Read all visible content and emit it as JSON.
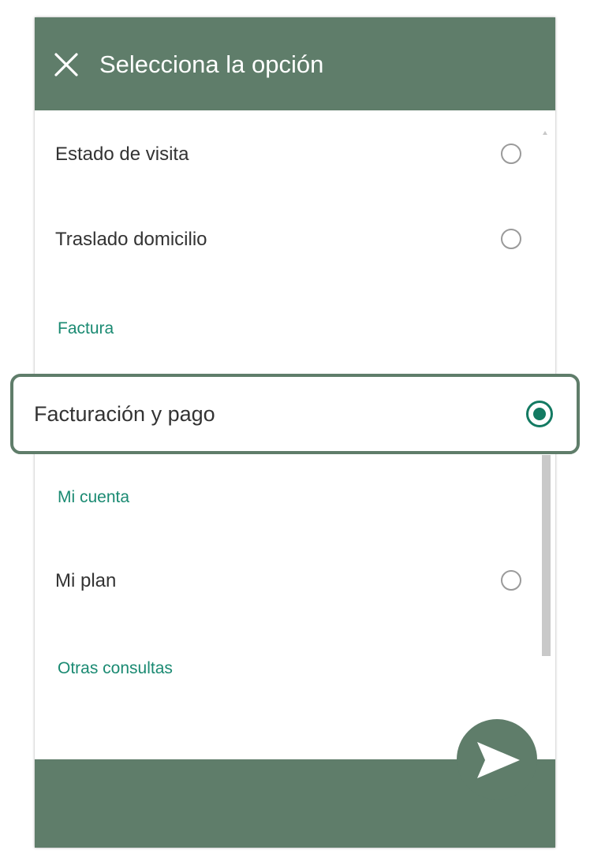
{
  "header": {
    "title": "Selecciona la opción",
    "close_icon": "close-icon"
  },
  "options": [
    {
      "label": "Estado de visita",
      "selected": false
    },
    {
      "label": "Traslado domicilio",
      "selected": false
    }
  ],
  "sections": {
    "factura": "Factura",
    "mi_cuenta": "Mi cuenta",
    "otras_consultas": "Otras consultas"
  },
  "selected_option": {
    "label": "Facturación y pago",
    "selected": true
  },
  "mi_cuenta_options": [
    {
      "label": "Mi plan",
      "selected": false
    }
  ],
  "send": {
    "icon": "send-icon"
  },
  "colors": {
    "brand_green": "#5f7d6a",
    "accent_teal": "#1a8a72",
    "radio_selected": "#137a62"
  }
}
